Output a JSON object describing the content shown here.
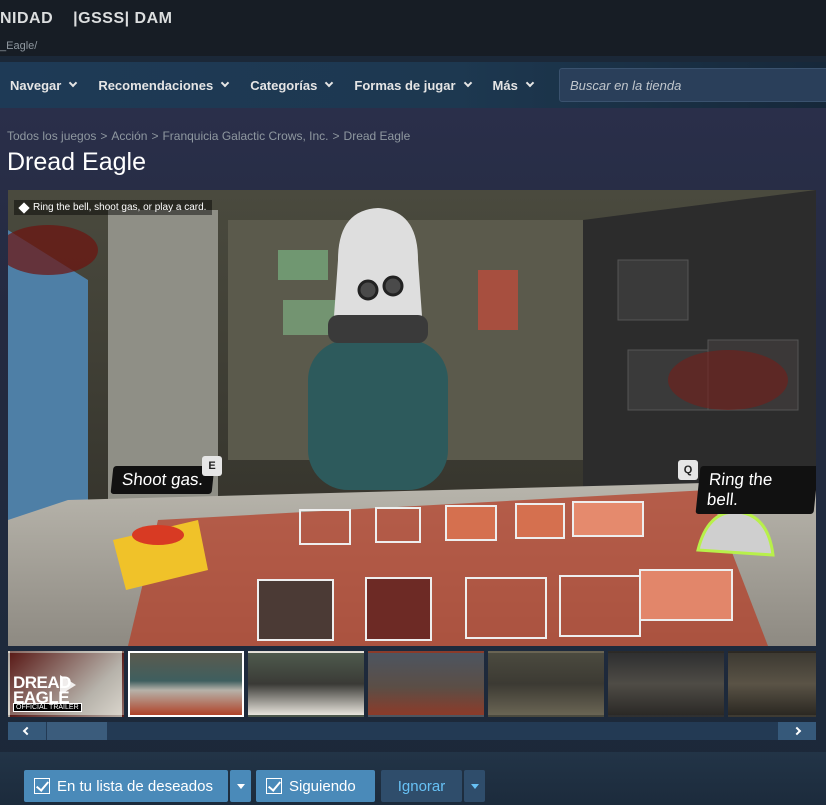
{
  "top_header": {
    "items": [
      "NIDAD",
      "|GSSS| DAM"
    ],
    "subtitle": "_Eagle/"
  },
  "store_nav": {
    "items": [
      {
        "label": "Navegar"
      },
      {
        "label": "Recomendaciones"
      },
      {
        "label": "Categorías"
      },
      {
        "label": "Formas de jugar"
      },
      {
        "label": "Más"
      }
    ],
    "search_placeholder": "Buscar en la tienda"
  },
  "breadcrumb": {
    "items": [
      "Todos los juegos",
      "Acción",
      "Franquicia Galactic Crows, Inc.",
      "Dread Eagle"
    ],
    "separator": ">"
  },
  "page_title": "Dread Eagle",
  "media": {
    "hint": "Ring the bell, shoot gas, or play a card.",
    "callout_left": "Shoot gas.",
    "key_left": "E",
    "callout_right": "Ring the bell.",
    "key_right": "Q"
  },
  "thumbnails": {
    "trailer_title_line1": "DREAD",
    "trailer_title_line2": "EAGLE",
    "trailer_badge": "OFFICIAL TRAILER",
    "count": 7,
    "selected_index": 1
  },
  "actions": {
    "wishlist_label": "En tu lista de deseados",
    "follow_label": "Siguiendo",
    "ignore_label": "Ignorar"
  },
  "colors": {
    "accent": "#67c1f5",
    "active_button": "#4a8ab9",
    "background": "#1b2838"
  }
}
